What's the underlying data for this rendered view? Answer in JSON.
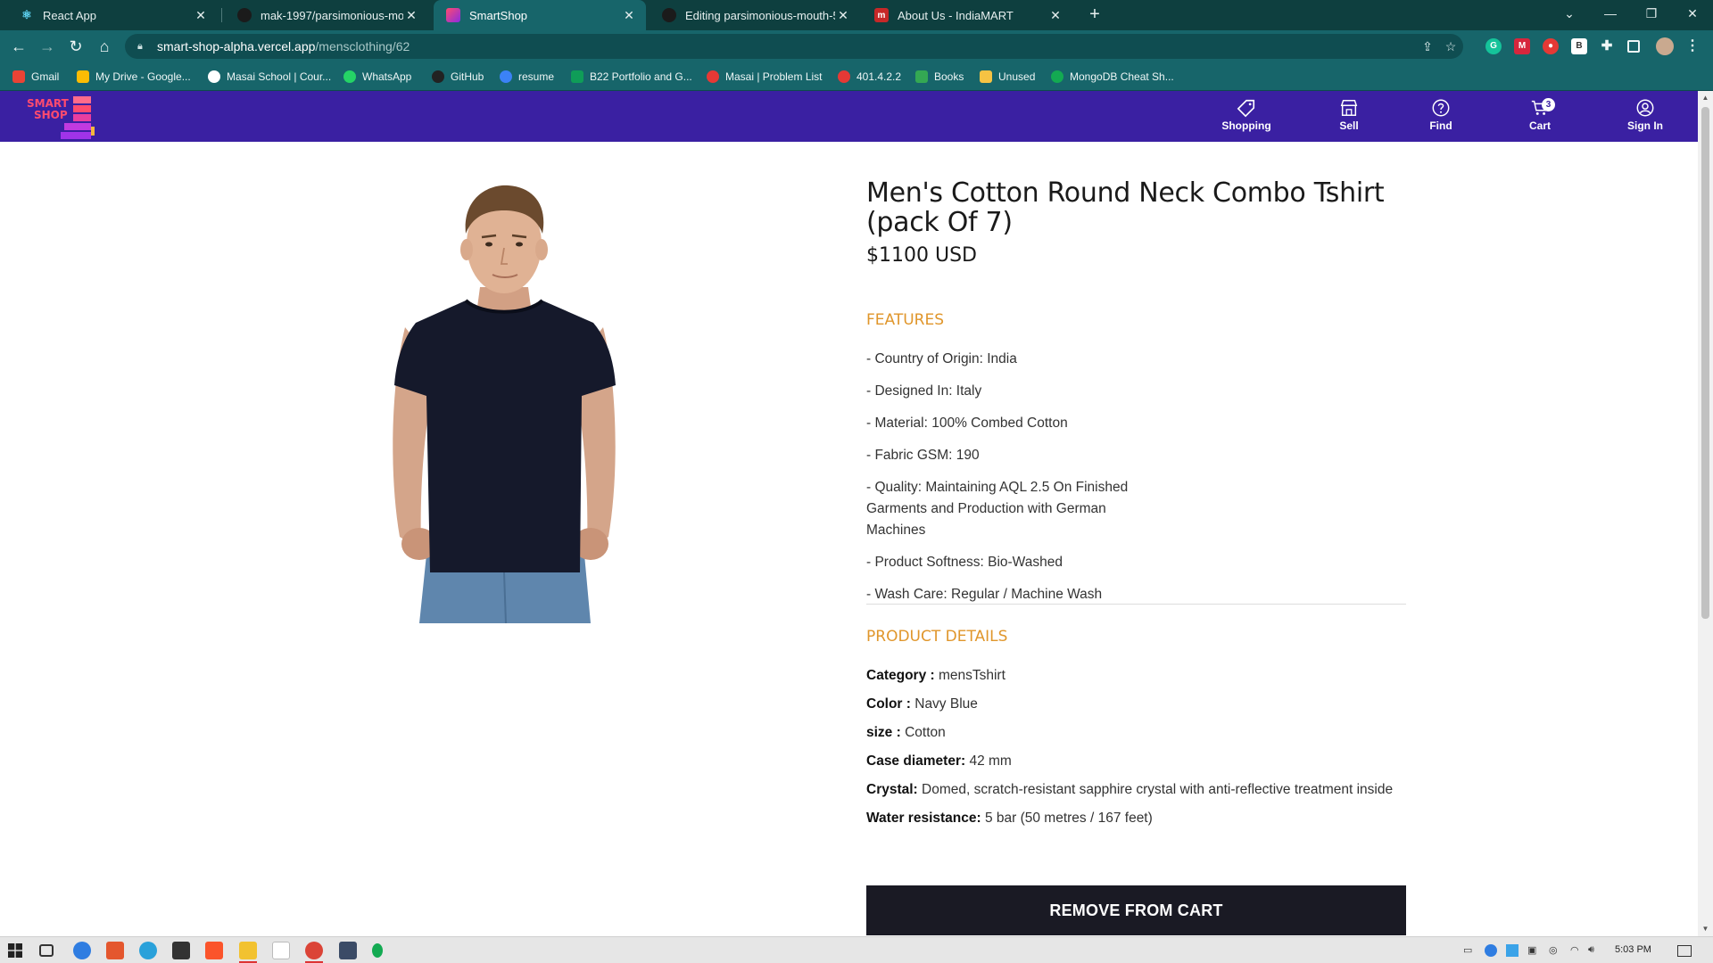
{
  "browser": {
    "tabs": [
      {
        "title": "React App",
        "active": false,
        "favicon_color": "#61dafb"
      },
      {
        "title": "mak-1997/parsimonious-mouth-",
        "active": false,
        "favicon_color": "#222222"
      },
      {
        "title": "SmartShop",
        "active": true,
        "favicon_color": "#b03ac7"
      },
      {
        "title": "Editing parsimonious-mouth-525",
        "active": false,
        "favicon_color": "#222222"
      },
      {
        "title": "About Us - IndiaMART",
        "active": false,
        "favicon_color": "#c62828"
      }
    ],
    "url_host": "smart-shop-alpha.vercel.app",
    "url_path": "/mensclothing/62",
    "bookmarks": [
      {
        "label": "Gmail",
        "color": "#ea4335"
      },
      {
        "label": "My Drive - Google...",
        "color": "#fbbc04"
      },
      {
        "label": "Masai School | Cour...",
        "color": "#ffffff"
      },
      {
        "label": "WhatsApp",
        "color": "#25d366"
      },
      {
        "label": "GitHub",
        "color": "#222222"
      },
      {
        "label": "resume",
        "color": "#3b82f6"
      },
      {
        "label": "B22 Portfolio and G...",
        "color": "#0f9d58"
      },
      {
        "label": "Masai | Problem List",
        "color": "#e53935"
      },
      {
        "label": "401.4.2.2",
        "color": "#e53935"
      },
      {
        "label": "Books",
        "color": "#34a853"
      },
      {
        "label": "Unused",
        "color": "#f6c343"
      },
      {
        "label": "MongoDB Cheat Sh...",
        "color": "#13aa52"
      }
    ]
  },
  "header": {
    "logo_line1": "SMART",
    "logo_line2": "SHOP",
    "nav": [
      {
        "label": "Shopping",
        "icon": "tag-icon"
      },
      {
        "label": "Sell",
        "icon": "store-icon"
      },
      {
        "label": "Find",
        "icon": "question-icon"
      },
      {
        "label": "Cart",
        "icon": "cart-icon"
      },
      {
        "label": "Sign In",
        "icon": "user-icon"
      }
    ],
    "cart_count": "3"
  },
  "product": {
    "title": "Men's Cotton Round Neck Combo Tshirt (pack Of 7)",
    "price": "$1100 USD",
    "features_heading": "FEATURES",
    "features": [
      "- Country of Origin: India",
      "- Designed In: Italy",
      "- Material: 100% Combed Cotton",
      "- Fabric GSM: 190",
      "- Quality: Maintaining AQL 2.5 On Finished Garments and Production with German Machines",
      "- Product Softness: Bio-Washed",
      "- Wash Care: Regular / Machine Wash"
    ],
    "details_heading": "PRODUCT DETAILS",
    "details": [
      {
        "label": "Category :",
        "value": " mensTshirt"
      },
      {
        "label": "Color :",
        "value": " Navy Blue"
      },
      {
        "label": "size :",
        "value": " Cotton"
      },
      {
        "label": "Case diameter:",
        "value": " 42 mm"
      },
      {
        "label": "Crystal:",
        "value": " Domed, scratch-resistant sapphire crystal with anti-reflective treatment inside"
      },
      {
        "label": "Water resistance:",
        "value": " 5 bar (50 metres / 167 feet)"
      }
    ],
    "cart_button": "REMOVE FROM CART"
  },
  "taskbar": {
    "time": "5:03 PM"
  }
}
